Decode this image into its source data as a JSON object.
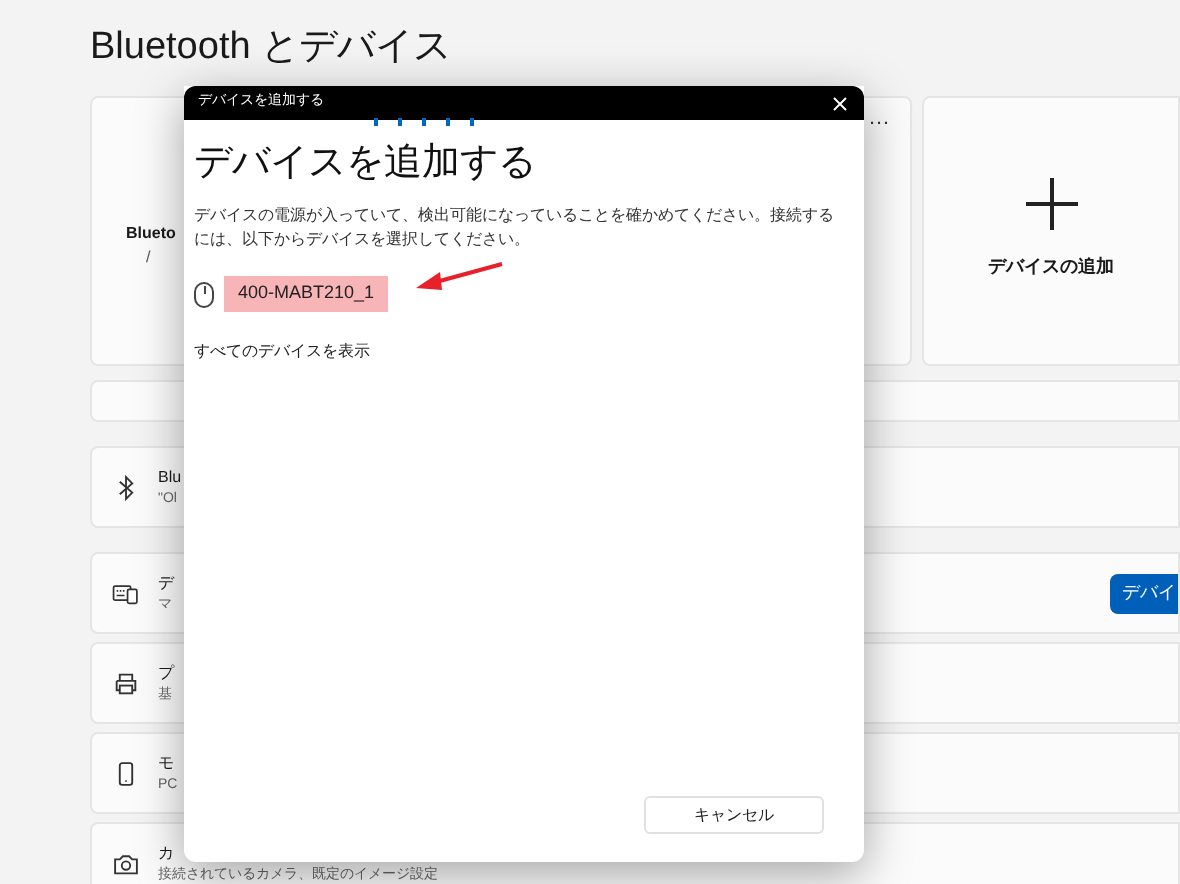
{
  "page": {
    "title": "Bluetooth とデバイス"
  },
  "top_cards": [
    {
      "kind": "bluetooth",
      "title": "Blueto",
      "subtitle": "/"
    },
    {
      "kind": "more",
      "label": "…"
    },
    {
      "kind": "add",
      "label": "デバイスの追加"
    }
  ],
  "rows": [
    {
      "kind": "blank"
    },
    {
      "kind": "bluetooth",
      "title": "Blu",
      "subtitle": "\"Ol"
    },
    {
      "kind": "devices",
      "title": "デ",
      "subtitle": "マ",
      "button": "デバイ"
    },
    {
      "kind": "printer",
      "title": "プ",
      "subtitle": "基"
    },
    {
      "kind": "phone",
      "title": "モ",
      "subtitle": "PC"
    },
    {
      "kind": "camera",
      "title": "カ",
      "subtitle": "接続されているカメラ、既定のイメージ設定"
    }
  ],
  "dialog": {
    "title": "デバイスを追加する",
    "heading": "デバイスを追加する",
    "description": "デバイスの電源が入っていて、検出可能になっていることを確かめてください。接続するには、以下からデバイスを選択してください。",
    "devices": [
      {
        "name": "400-MABT210_1",
        "highlighted": true
      }
    ],
    "show_all": "すべてのデバイスを表示",
    "cancel": "キャンセル"
  }
}
